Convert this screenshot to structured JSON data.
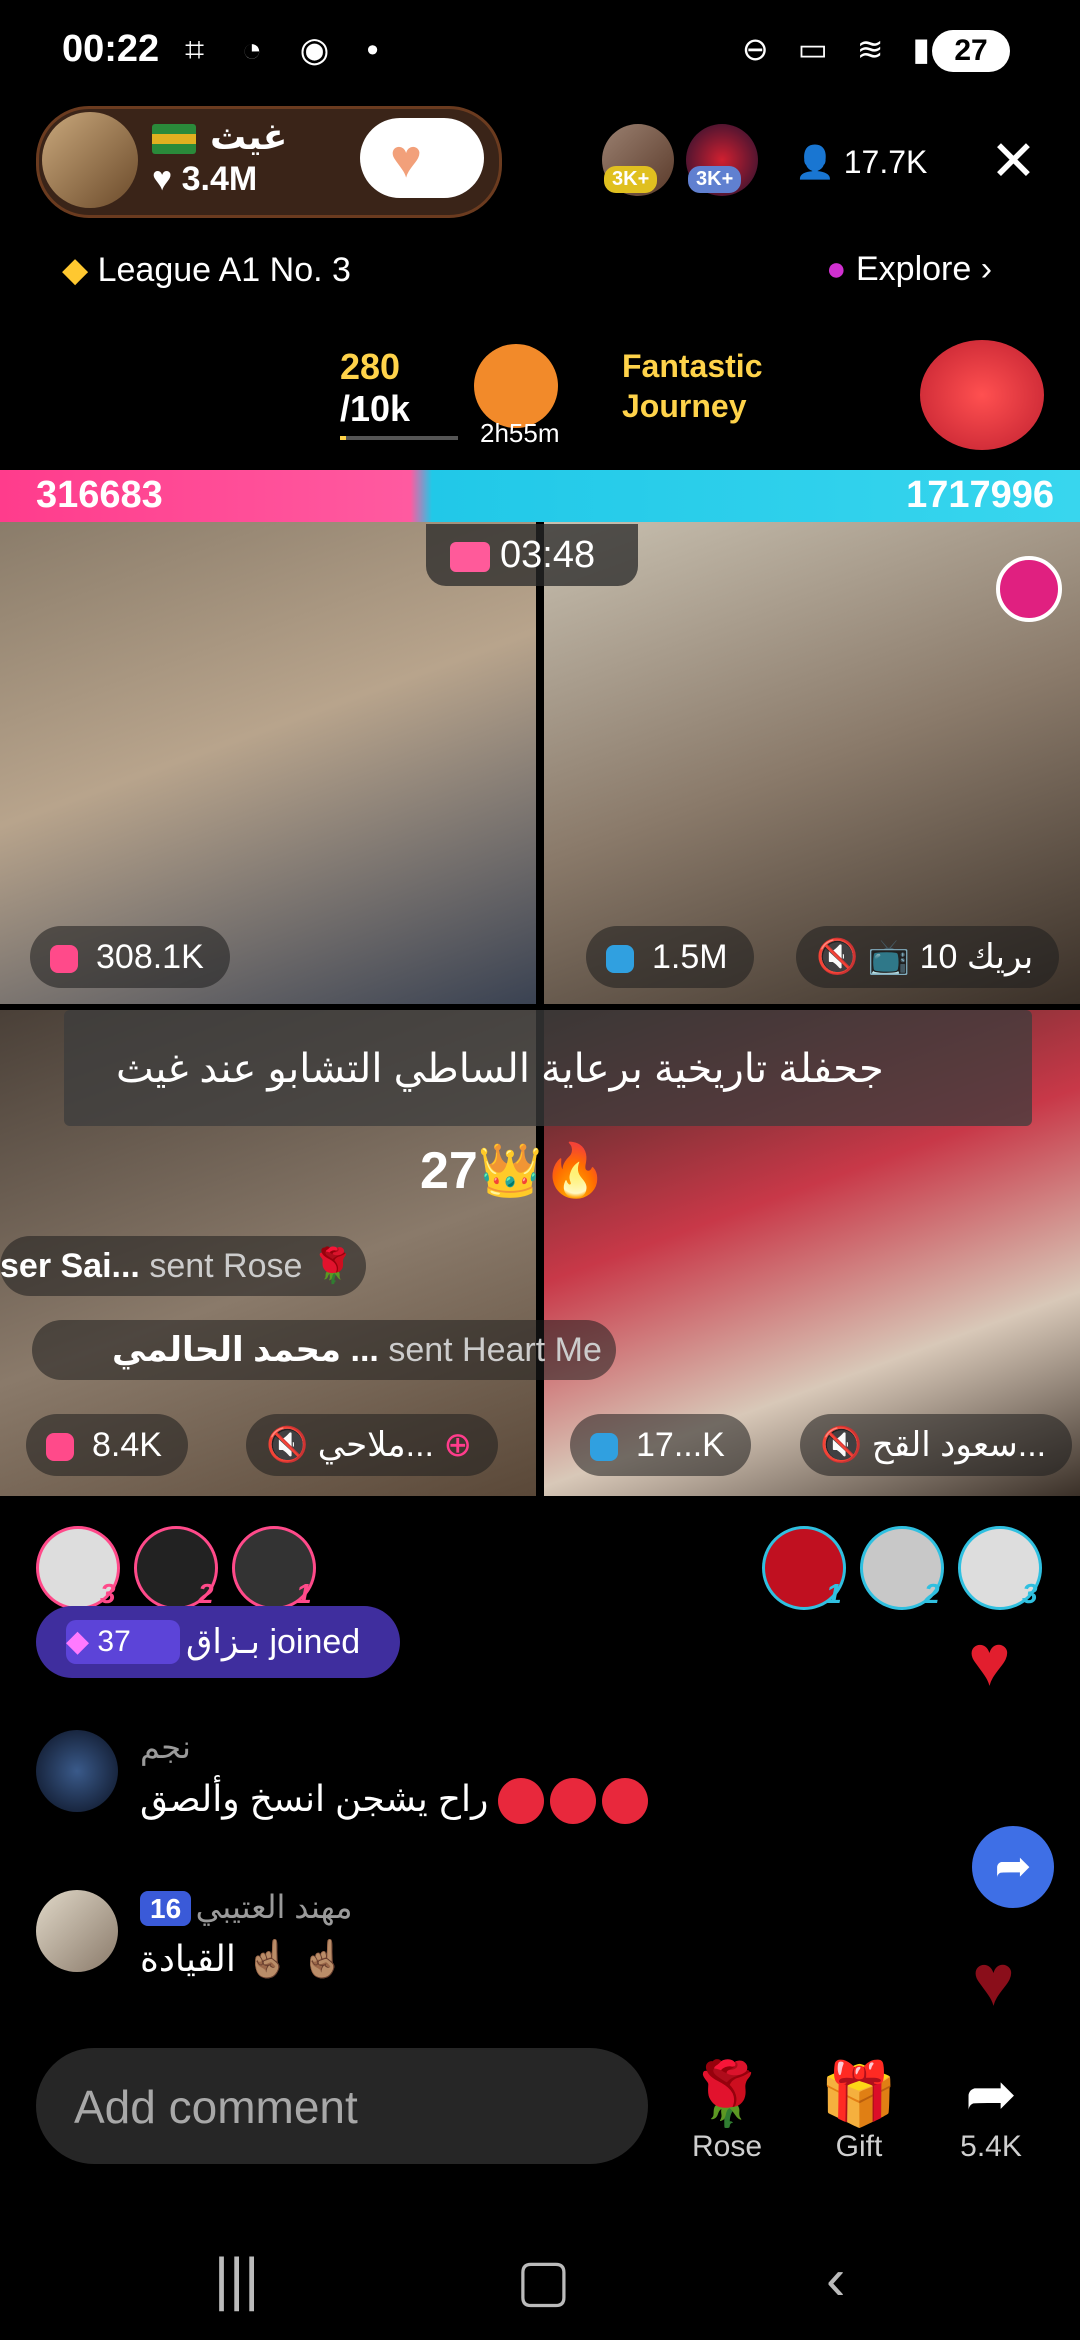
{
  "status": {
    "time": "00:22",
    "battery": "27"
  },
  "host": {
    "name": "غيث",
    "likes": "3.4M"
  },
  "viewers": {
    "badges": [
      "3K+",
      "3K+"
    ],
    "count": "17.7K"
  },
  "league": "League A1 No. 3",
  "explore": "Explore",
  "event": {
    "progress_num": "280",
    "progress_den": "/10k",
    "timer": "2h55m",
    "title_line1": "Fantastic",
    "title_line2": "Journey"
  },
  "battle": {
    "left_score": "316683",
    "right_score": "1717996",
    "countdown": "03:48"
  },
  "tiles": [
    {
      "likes": "308.1K"
    },
    {
      "likes": "1.5M",
      "name": "بريك",
      "name_count": "10"
    },
    {
      "likes": "8.4K",
      "name": "ملاحي..."
    },
    {
      "likes": "17...K",
      "name": "سعود القح..."
    }
  ],
  "banner": "جحفلة تاريخية برعاية الساطي التشابو عند غيث",
  "crown_count": "27",
  "gift_msgs": [
    {
      "sender": "ser Sai...",
      "action": "sent Rose"
    },
    {
      "sender": "محمد الحالمي ...",
      "action": "sent Heart Me"
    }
  ],
  "ranks_left": [
    "3",
    "2",
    "1"
  ],
  "ranks_right": [
    "1",
    "2",
    "3"
  ],
  "joined": {
    "level": "37",
    "text": "بـزاق joined"
  },
  "comments": [
    {
      "name": "نجم",
      "text": "راح يشجن انسخ وألصق"
    },
    {
      "name": "مهند العتيبي",
      "level": "16",
      "text": "القيادة ☝🏽 ☝🏽"
    }
  ],
  "comment_placeholder": "Add comment",
  "actions": {
    "rose": "Rose",
    "gift": "Gift",
    "share_count": "5.4K"
  },
  "colors": {
    "score_left": "#ff3c8c",
    "score_right": "#21c8e8",
    "like_red": "#e21e2e"
  }
}
